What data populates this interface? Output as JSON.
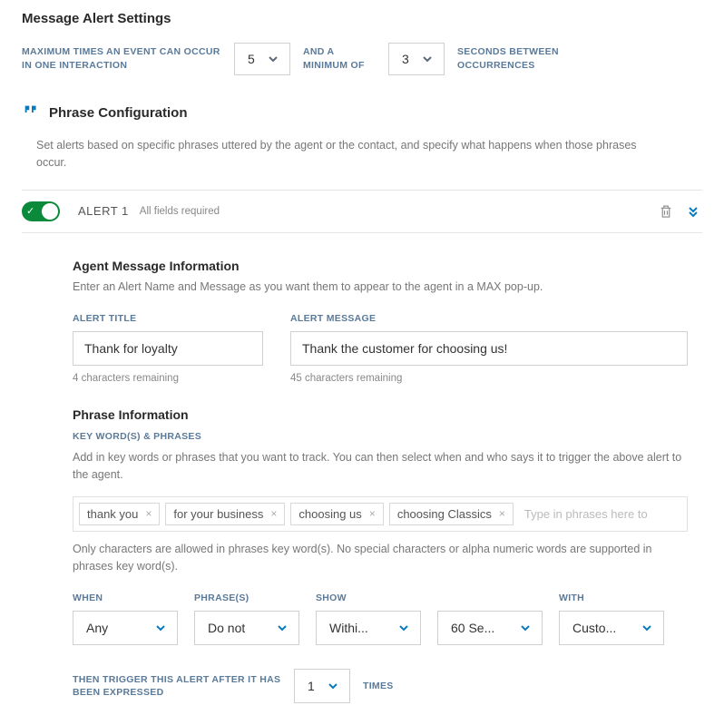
{
  "header": {
    "title": "Message Alert Settings",
    "max_times_label": "MAXIMUM TIMES AN EVENT CAN OCCUR IN ONE INTERACTION",
    "max_times_value": "5",
    "and_min_label": "AND A MINIMUM OF",
    "and_min_value": "3",
    "seconds_label": "SECONDS BETWEEN OCCURRENCES"
  },
  "phrase_config": {
    "title": "Phrase Configuration",
    "description": "Set alerts based on specific phrases uttered by the agent or the contact, and specify what happens when those phrases occur."
  },
  "alert": {
    "name": "ALERT 1",
    "required_text": "All fields required",
    "agent_info": {
      "title": "Agent Message Information",
      "description": "Enter an Alert Name and Message as you want them to appear to the agent in a MAX pop-up.",
      "alert_title_label": "ALERT TITLE",
      "alert_title_value": "Thank for loyalty",
      "alert_title_hint": "4 characters remaining",
      "alert_msg_label": "ALERT MESSAGE",
      "alert_msg_value": "Thank the customer for choosing us!",
      "alert_msg_hint": "45 characters remaining"
    },
    "phrase_info": {
      "title": "Phrase Information",
      "keywords_label": "KEY WORD(S) & PHRASES",
      "keywords_desc": "Add in key words or phrases that you want to track. You can then select when and who says it to trigger the above alert to the agent.",
      "tags": [
        "thank you",
        "for your business",
        "choosing us",
        "choosing Classics"
      ],
      "tag_placeholder": "Type in phrases here to",
      "keywords_note": "Only characters are allowed in phrases key word(s). No special characters or alpha numeric words are supported in phrases key word(s).",
      "params": {
        "when_label": "WHEN",
        "when_value": "Any",
        "phrases_label": "PHRASE(S)",
        "phrases_value": "Do not",
        "show_label": "SHOW",
        "show_value": "Withi...",
        "blank_label": "",
        "blank_value": "60 Se...",
        "with_label": "WITH",
        "with_value": "Custo..."
      },
      "trigger_label": "THEN TRIGGER THIS ALERT AFTER IT HAS BEEN EXPRESSED",
      "trigger_value": "1",
      "trigger_after": "TIMES"
    }
  }
}
